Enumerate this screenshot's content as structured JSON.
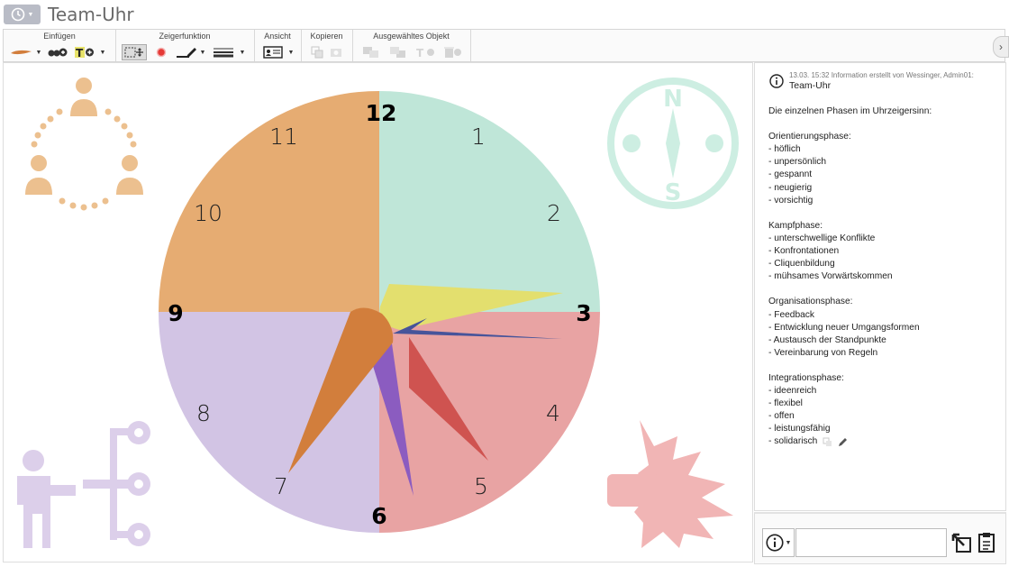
{
  "window": {
    "title": "Team-Uhr",
    "app_icon": "clock-icon"
  },
  "toolbar": {
    "groups": [
      {
        "label": "Einfügen"
      },
      {
        "label": "Zeigerfunktion"
      },
      {
        "label": "Ansicht"
      },
      {
        "label": "Kopieren"
      },
      {
        "label": "Ausgewähltes Objekt"
      }
    ]
  },
  "clock": {
    "numbers": [
      "12",
      "1",
      "2",
      "3",
      "4",
      "5",
      "6",
      "7",
      "8",
      "9",
      "10",
      "11"
    ],
    "sector_colors": {
      "orientation": "#bfe6d8",
      "conflict": "#e8a3a3",
      "organisation": "#d2c4e4",
      "integration": "#e6ac72"
    },
    "hand_colors": [
      "#e3df6e",
      "#47549a",
      "#cf5350",
      "#8b5cc0",
      "#d27e3c"
    ]
  },
  "info": {
    "meta": "13.03. 15:32 Information erstellt von Wessinger, Admin01:",
    "title": "Team-Uhr",
    "lines": [
      "Die einzelnen Phasen im Uhrzeigersinn:",
      "",
      "Orientierungsphase:",
      "- höflich",
      "- unpersönlich",
      "- gespannt",
      "- neugierig",
      "- vorsichtig",
      "",
      "Kampfphase:",
      "- unterschwellige Konflikte",
      "- Konfrontationen",
      "- Cliquenbildung",
      "- mühsames Vorwärtskommen",
      "",
      "Organisationsphase:",
      "- Feedback",
      "- Entwicklung neuer Umgangsformen",
      "- Austausch der Standpunkte",
      "- Vereinbarung von Regeln",
      "",
      "Integrationsphase:",
      "- ideenreich",
      "- flexibel",
      "- offen",
      "- leistungsfähig",
      "- solidarisch"
    ]
  },
  "footer": {
    "input_placeholder": ""
  }
}
